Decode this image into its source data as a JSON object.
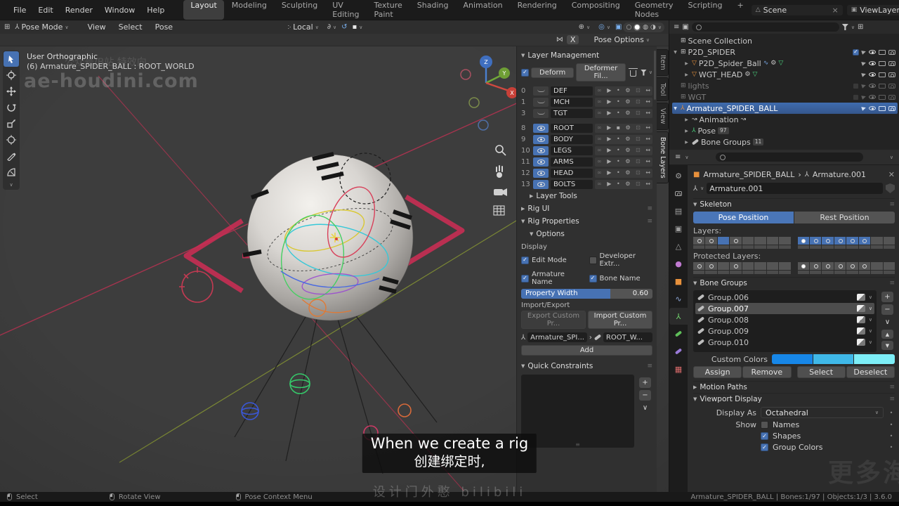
{
  "menubar": {
    "app_menus": [
      "File",
      "Edit",
      "Render",
      "Window",
      "Help"
    ],
    "workspaces": [
      "Layout",
      "Modeling",
      "Sculpting",
      "UV Editing",
      "Texture Paint",
      "Shading",
      "Animation",
      "Rendering",
      "Compositing",
      "Geometry Nodes",
      "Scripting"
    ],
    "new_workspace_label": "+",
    "active_workspace": "Layout",
    "scene_name": "Scene",
    "view_layer_name": "ViewLayer"
  },
  "vp_header": {
    "mode": "Pose Mode",
    "menu_view": "View",
    "menu_select": "Select",
    "menu_pose": "Pose",
    "orientation": "Local"
  },
  "tool_settings": {
    "mirror_x": "X",
    "pose_options": "Pose Options"
  },
  "viewport": {
    "view_label": "User Orthographic",
    "context_label": "(6) Armature_SPIDER_BALL : ROOT_WORLD",
    "watermark": "ae-houdini.com",
    "watermark_cn": "公众号/B站 特效向",
    "axis_x": "X",
    "axis_y": "Y",
    "axis_z": "Z"
  },
  "npanel": {
    "tabs": [
      "Item",
      "Tool",
      "View",
      "Bone Layers"
    ],
    "active_tab": "Bone Layers",
    "layer_management": {
      "title": "Layer Management",
      "deform": "Deform",
      "deformer_filter": "Deformer Fil...",
      "layers": [
        {
          "index": "0",
          "name": "DEF",
          "visible": false
        },
        {
          "index": "1",
          "name": "MCH",
          "visible": false
        },
        {
          "index": "3",
          "name": "TGT",
          "visible": false
        },
        {
          "index": "8",
          "name": "ROOT",
          "visible": true
        },
        {
          "index": "9",
          "name": "BODY",
          "visible": true
        },
        {
          "index": "10",
          "name": "LEGS",
          "visible": true
        },
        {
          "index": "11",
          "name": "ARMS",
          "visible": true
        },
        {
          "index": "12",
          "name": "HEAD",
          "visible": true
        },
        {
          "index": "13",
          "name": "BOLTS",
          "visible": true
        }
      ],
      "layer_tools": "Layer Tools"
    },
    "rig_ui": "Rig UI",
    "rig_properties": "Rig Properties",
    "options": "Options",
    "display": {
      "label": "Display",
      "edit_mode": "Edit Mode",
      "developer_extras": "Developer Extr...",
      "armature_name": "Armature Name",
      "bone_name": "Bone Name",
      "property_width": "Property Width",
      "property_width_value": "0.60"
    },
    "import_export": {
      "label": "Import/Export",
      "export_button": "Export Custom Pr...",
      "import_button": "Import Custom Pr...",
      "armature_field": "Armature_SPI...",
      "bone_field": "ROOT_W...",
      "add_button": "Add"
    },
    "quick_constraints": {
      "title": "Quick Constraints"
    }
  },
  "outliner": {
    "rows": [
      {
        "name": "Scene Collection"
      },
      {
        "name": "P2D_SPIDER"
      },
      {
        "name": "P2D_Spider_Ball"
      },
      {
        "name": "WGT_HEAD"
      },
      {
        "name": "lights"
      },
      {
        "name": "WGT"
      },
      {
        "name": "Armature_SPIDER_BALL"
      },
      {
        "name": "Animation"
      },
      {
        "name": "Pose",
        "badge": "97"
      },
      {
        "name": "Bone Groups",
        "badge": "11"
      }
    ]
  },
  "properties": {
    "breadcrumb": {
      "object": "Armature_SPIDER_BALL",
      "separator": "›",
      "data": "Armature.001"
    },
    "datablock_name": "Armature.001",
    "skeleton": {
      "title": "Skeleton",
      "pose_position": "Pose Position",
      "rest_position": "Rest Position",
      "layers_label": "Layers:",
      "protected_layers_label": "Protected Layers:"
    },
    "bone_groups": {
      "title": "Bone Groups",
      "selected": "Group.007",
      "groups": [
        {
          "name": "Group.006"
        },
        {
          "name": "Group.007"
        },
        {
          "name": "Group.008"
        },
        {
          "name": "Group.009"
        },
        {
          "name": "Group.010"
        }
      ],
      "custom_colors_label": "Custom Colors",
      "colors": [
        "#1787e8",
        "#3fb8e8",
        "#7deef7"
      ],
      "assign": "Assign",
      "remove": "Remove",
      "select": "Select",
      "deselect": "Deselect"
    },
    "motion_paths": "Motion Paths",
    "viewport_display": {
      "title": "Viewport Display",
      "display_as_label": "Display As",
      "display_as_value": "Octahedral",
      "show_label": "Show",
      "names": "Names",
      "shapes": "Shapes",
      "group_colors": "Group Colors"
    }
  },
  "statusbar": {
    "select": "Select",
    "rotate_view": "Rotate View",
    "pose_context_menu": "Pose Context Menu",
    "right_info": "Armature_SPIDER_BALL | Bones:1/97 | Objects:1/3 | 3.6.0"
  },
  "subtitle": {
    "line1": "When we create a rig",
    "line2": "创建绑定时,",
    "watermark": "设计门外憨 bilibili",
    "corner_watermark": "更多海"
  },
  "icons": {
    "chevron": "∨",
    "caret_down": "▼",
    "caret_right": "▶",
    "link": "∞",
    "select_arrow": "▶",
    "dot": "•",
    "gear": "⚙",
    "lock": "⊡",
    "resize": "↔",
    "plus": "+",
    "minus": "−",
    "down": "∨",
    "up_tri": "▲",
    "down_tri": "▼",
    "grid": "⊞",
    "figure": "⅄",
    "bowtie": "⋈",
    "pivot": "჻",
    "snap": "∂",
    "spiral": "↺",
    "square": "▪",
    "gizmo": "⊕",
    "overlay": "◎",
    "xray": "▣",
    "shade_wire": "○",
    "shade_solid": "●",
    "shade_mat": "◍",
    "shade_rend": "◑",
    "close": "×",
    "menu": "≡",
    "mesh_tri": "▽",
    "anim": "↝",
    "wave": "∿",
    "tool_gear": "⚙",
    "printer": "▤",
    "layers_sq": "▣",
    "scene_cone": "△",
    "world_ball": "●",
    "object_sq": "■",
    "texture_chk": "▦",
    "pin": "✕",
    "arrow_r": "›"
  },
  "colors": {
    "accent": "#4772b3"
  }
}
